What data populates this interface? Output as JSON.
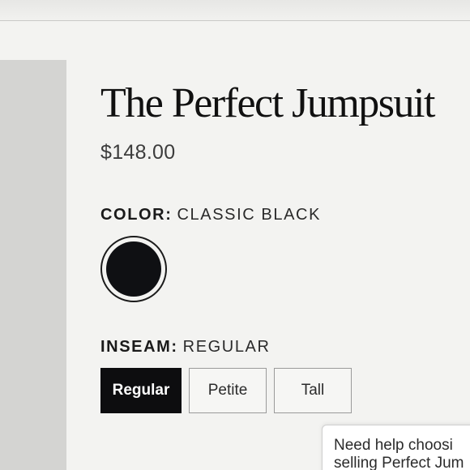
{
  "product": {
    "title": "The Perfect Jumpsuit",
    "price": "$148.00"
  },
  "color": {
    "label": "COLOR:",
    "value": "CLASSIC BLACK",
    "swatch_hex": "#0f1013"
  },
  "inseam": {
    "label": "INSEAM:",
    "value": "REGULAR",
    "options": [
      "Regular",
      "Petite",
      "Tall"
    ],
    "selected": "Regular"
  },
  "chat": {
    "line1": "Need help choosi",
    "line2": "selling Perfect Jum"
  }
}
